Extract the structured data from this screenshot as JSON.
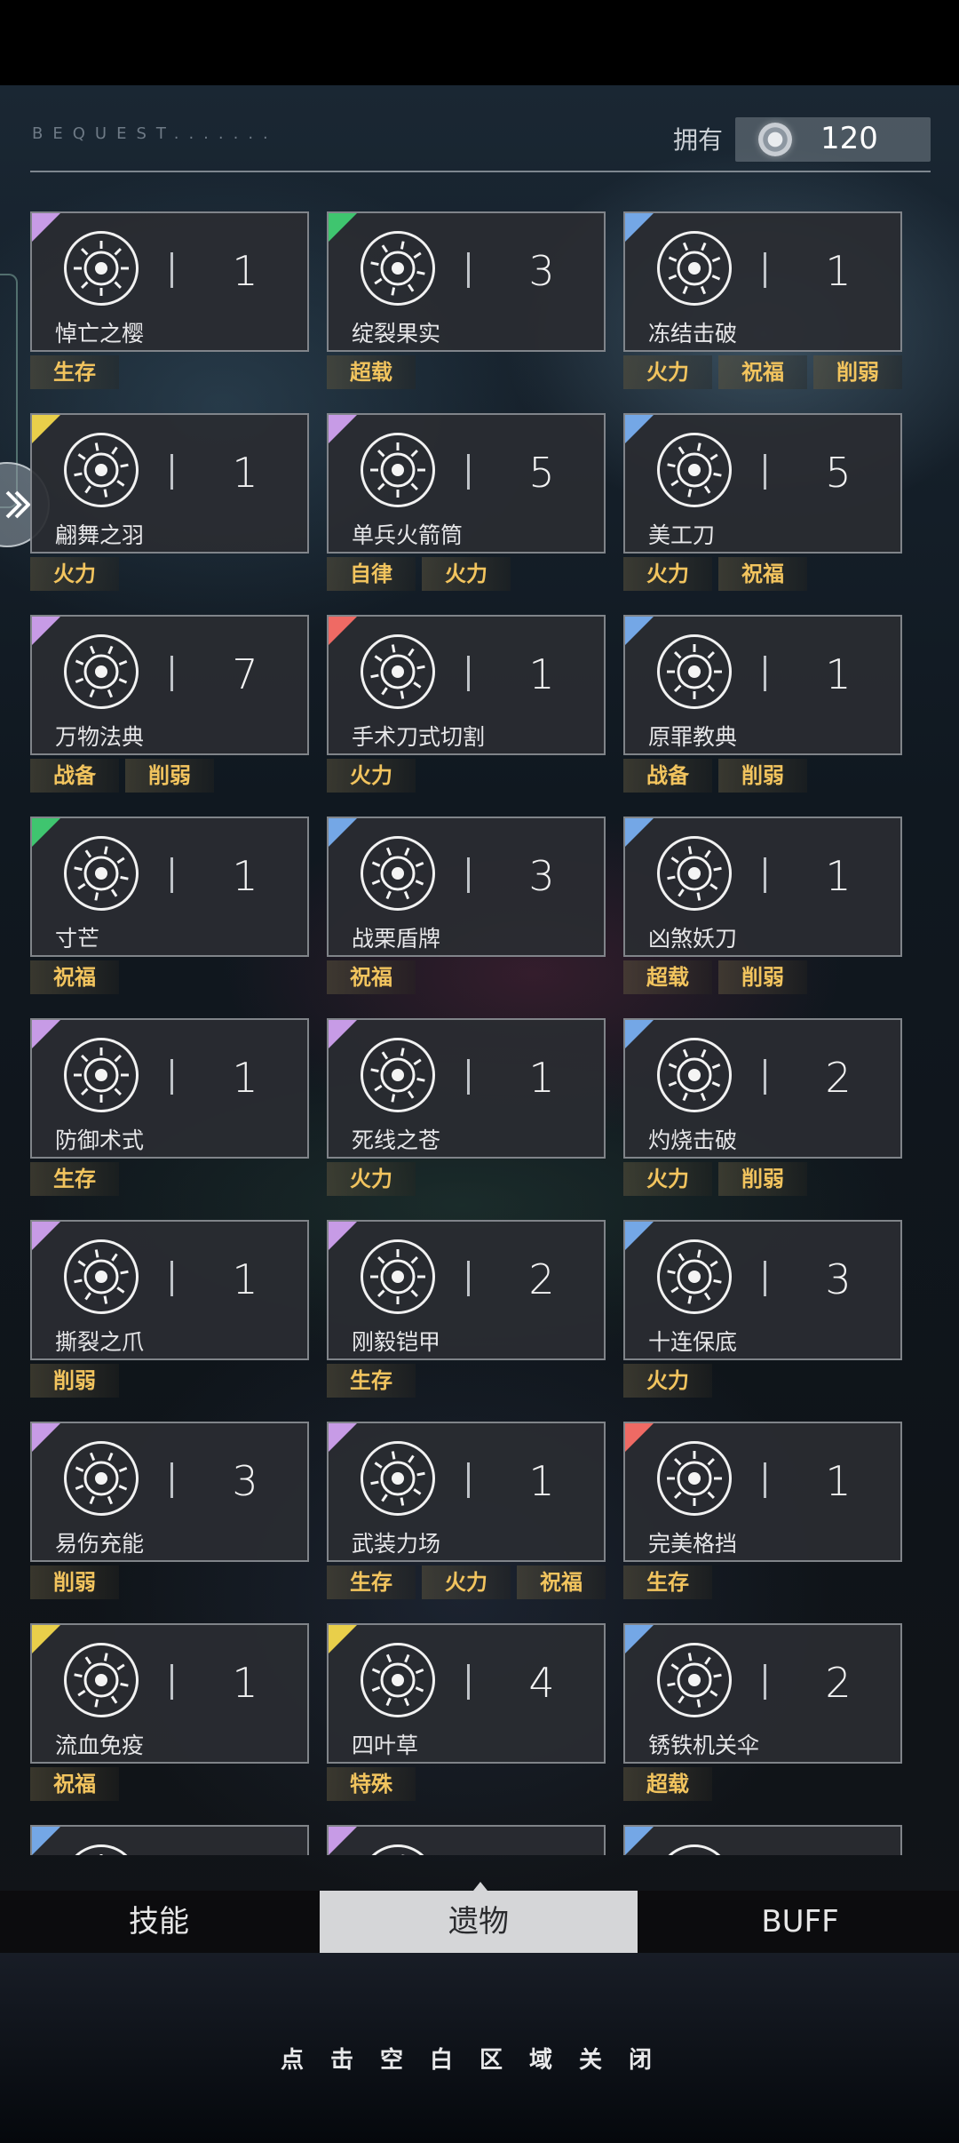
{
  "header": {
    "title": "BEQUEST.......",
    "owned_label": "拥有",
    "owned_count": "120",
    "owned_icon": "currency-coin-icon"
  },
  "rarity_colors": {
    "purple": "#c79be6",
    "green": "#3fc56f",
    "blue": "#74a7e6",
    "gold": "#e9cf4a",
    "red": "#ef6a64"
  },
  "tag_color": "#f2c45e",
  "relics": [
    {
      "name": "悼亡之樱",
      "count": "1",
      "rarity": "purple",
      "icon": "sakura-flower-icon",
      "tags": [
        "生存"
      ]
    },
    {
      "name": "绽裂果实",
      "count": "3",
      "rarity": "green",
      "icon": "spiked-fruit-icon",
      "tags": [
        "超载"
      ]
    },
    {
      "name": "冻结击破",
      "count": "1",
      "rarity": "blue",
      "icon": "ice-shatter-icon",
      "tags": [
        "火力",
        "祝福",
        "削弱"
      ]
    },
    {
      "name": "翩舞之羽",
      "count": "1",
      "rarity": "gold",
      "icon": "feather-icon",
      "tags": [
        "火力"
      ]
    },
    {
      "name": "单兵火箭筒",
      "count": "5",
      "rarity": "purple",
      "icon": "rocket-launcher-icon",
      "tags": [
        "自律",
        "火力"
      ]
    },
    {
      "name": "美工刀",
      "count": "5",
      "rarity": "blue",
      "icon": "utility-knife-icon",
      "tags": [
        "火力",
        "祝福"
      ]
    },
    {
      "name": "万物法典",
      "count": "7",
      "rarity": "purple",
      "icon": "law-book-icon",
      "tags": [
        "战备",
        "削弱"
      ]
    },
    {
      "name": "手术刀式切割",
      "count": "1",
      "rarity": "red",
      "icon": "scalpel-slash-icon",
      "tags": [
        "火力"
      ]
    },
    {
      "name": "原罪教典",
      "count": "1",
      "rarity": "blue",
      "icon": "scripture-book-icon",
      "tags": [
        "战备",
        "削弱"
      ]
    },
    {
      "name": "寸芒",
      "count": "1",
      "rarity": "green",
      "icon": "triangle-burst-icon",
      "tags": [
        "祝福"
      ]
    },
    {
      "name": "战栗盾牌",
      "count": "3",
      "rarity": "blue",
      "icon": "shield-icon",
      "tags": [
        "祝福"
      ]
    },
    {
      "name": "凶煞妖刀",
      "count": "1",
      "rarity": "blue",
      "icon": "demon-blade-icon",
      "tags": [
        "超载",
        "削弱"
      ]
    },
    {
      "name": "防御术式",
      "count": "1",
      "rarity": "purple",
      "icon": "defense-shield-icon",
      "tags": [
        "生存"
      ]
    },
    {
      "name": "死线之苍",
      "count": "1",
      "rarity": "purple",
      "icon": "star-burst-icon",
      "tags": [
        "火力"
      ]
    },
    {
      "name": "灼烧击破",
      "count": "2",
      "rarity": "blue",
      "icon": "flame-burst-icon",
      "tags": [
        "火力",
        "削弱"
      ]
    },
    {
      "name": "撕裂之爪",
      "count": "1",
      "rarity": "purple",
      "icon": "claw-icon",
      "tags": [
        "削弱"
      ]
    },
    {
      "name": "刚毅铠甲",
      "count": "2",
      "rarity": "purple",
      "icon": "armor-icon",
      "tags": [
        "生存"
      ]
    },
    {
      "name": "十连保底",
      "count": "3",
      "rarity": "blue",
      "icon": "ten-pull-ball-icon",
      "tags": [
        "火力"
      ]
    },
    {
      "name": "易伤充能",
      "count": "3",
      "rarity": "purple",
      "icon": "vulnerable-charge-icon",
      "tags": [
        "削弱"
      ]
    },
    {
      "name": "武装力场",
      "count": "1",
      "rarity": "purple",
      "icon": "hexagon-field-icon",
      "tags": [
        "生存",
        "火力",
        "祝福"
      ]
    },
    {
      "name": "完美格挡",
      "count": "1",
      "rarity": "red",
      "icon": "parry-icon",
      "tags": [
        "生存"
      ]
    },
    {
      "name": "流血免疫",
      "count": "1",
      "rarity": "gold",
      "icon": "blood-immune-icon",
      "tags": [
        "祝福"
      ]
    },
    {
      "name": "四叶草",
      "count": "4",
      "rarity": "gold",
      "icon": "four-leaf-clover-icon",
      "tags": [
        "特殊"
      ]
    },
    {
      "name": "锈铁机关伞",
      "count": "2",
      "rarity": "blue",
      "icon": "umbrella-icon",
      "tags": [
        "超载"
      ]
    },
    {
      "name": "",
      "count": "",
      "rarity": "blue",
      "icon": "relic-icon",
      "tags": []
    },
    {
      "name": "",
      "count": "",
      "rarity": "purple",
      "icon": "relic-icon",
      "tags": []
    },
    {
      "name": "",
      "count": "",
      "rarity": "blue",
      "icon": "relic-icon",
      "tags": []
    }
  ],
  "tabs": [
    {
      "label": "技能",
      "active": false
    },
    {
      "label": "遗物",
      "active": true
    },
    {
      "label": "BUFF",
      "active": false
    }
  ],
  "footer": {
    "close_hint": "点击空白区域关闭"
  }
}
